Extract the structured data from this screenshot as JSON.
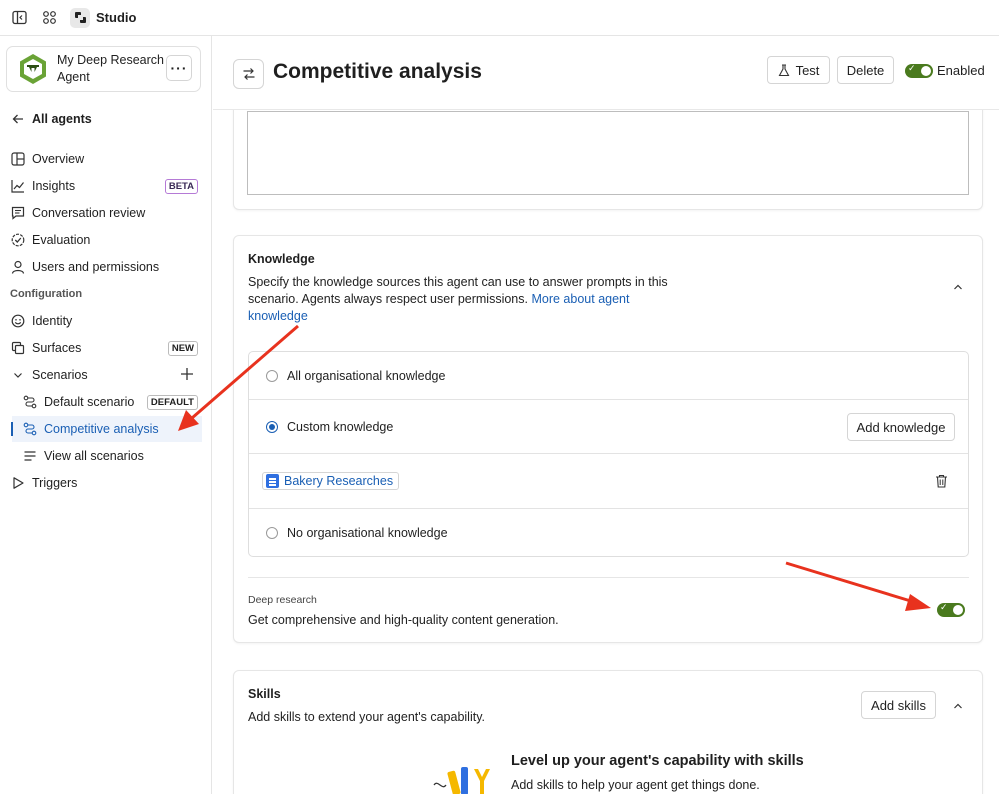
{
  "topbar": {
    "app_name": "Studio"
  },
  "agent": {
    "name": "My Deep Research Agent",
    "more_label": "···"
  },
  "sidebar": {
    "back_label": "All agents",
    "items": [
      {
        "label": "Overview"
      },
      {
        "label": "Insights",
        "badge": "BETA"
      },
      {
        "label": "Conversation review"
      },
      {
        "label": "Evaluation"
      },
      {
        "label": "Users and permissions"
      }
    ],
    "config_section": "Configuration",
    "config_items": [
      {
        "label": "Identity"
      },
      {
        "label": "Surfaces",
        "badge": "NEW"
      },
      {
        "label": "Scenarios"
      }
    ],
    "scenarios": [
      {
        "label": "Default scenario",
        "badge": "DEFAULT"
      },
      {
        "label": "Competitive analysis"
      },
      {
        "label": "View all scenarios"
      }
    ],
    "triggers_label": "Triggers"
  },
  "header": {
    "title": "Competitive analysis",
    "test_label": "Test",
    "delete_label": "Delete",
    "enabled_label": "Enabled"
  },
  "knowledge": {
    "title": "Knowledge",
    "desc_line1": "Specify the knowledge sources this agent can use to answer prompts in this",
    "desc_line2": "scenario. Agents always respect user permissions.",
    "link_line2": "More about agent",
    "link_line3": "knowledge",
    "options": {
      "all": "All organisational knowledge",
      "custom": "Custom knowledge",
      "none": "No organisational knowledge"
    },
    "add_knowledge_label": "Add knowledge",
    "source_label": "Bakery Researches"
  },
  "deep_research": {
    "title": "Deep research",
    "description": "Get comprehensive and high-quality content generation."
  },
  "skills": {
    "title": "Skills",
    "description": "Add skills to extend your agent's capability.",
    "add_label": "Add skills",
    "promo_title": "Level up your agent's capability with skills",
    "promo_desc": "Add skills to help your agent get things done."
  },
  "colors": {
    "accent": "#1a5fb4",
    "toggle_on": "#4a7a1e",
    "annotation_arrow": "#e8321e"
  }
}
